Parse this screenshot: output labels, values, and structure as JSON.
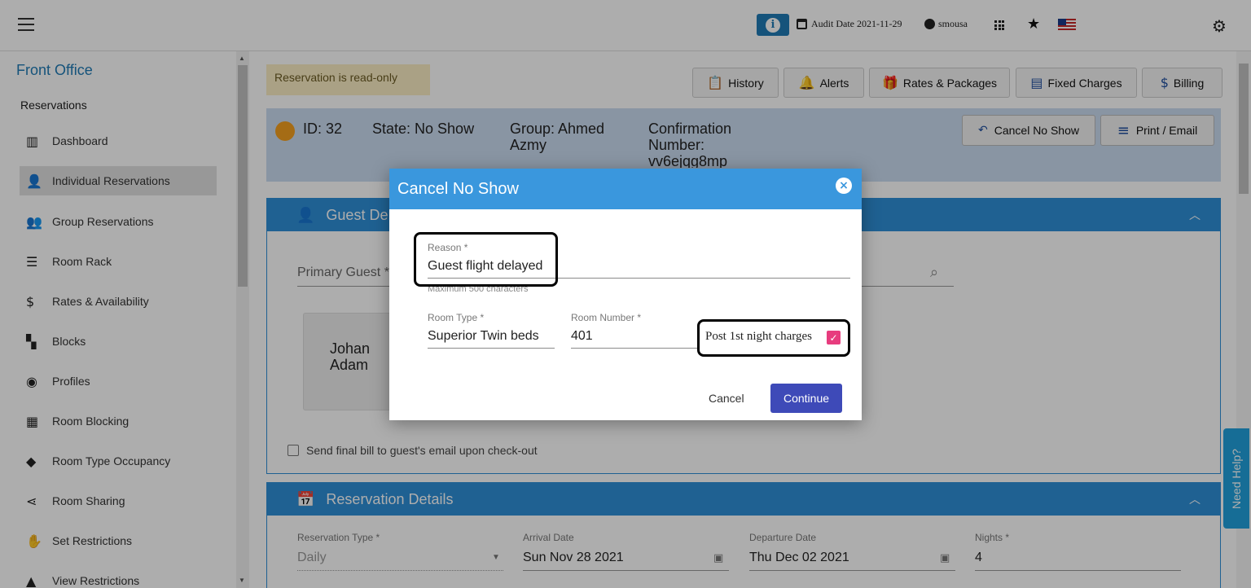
{
  "topbar": {
    "audit_label": "Audit Date 2021-11-29",
    "username": "smousa",
    "info_glyph": "i"
  },
  "sidebar": {
    "section_title": "Front Office",
    "group_title": "Reservations",
    "items": [
      {
        "label": "Dashboard",
        "icon": "dashboard-icon"
      },
      {
        "label": "Individual Reservations",
        "icon": "person-icon"
      },
      {
        "label": "Group Reservations",
        "icon": "group-icon"
      },
      {
        "label": "Room Rack",
        "icon": "list-icon"
      },
      {
        "label": "Rates & Availability",
        "icon": "dollar-icon"
      },
      {
        "label": "Blocks",
        "icon": "blocks-icon"
      },
      {
        "label": "Profiles",
        "icon": "profile-icon"
      },
      {
        "label": "Room Blocking",
        "icon": "table-icon"
      },
      {
        "label": "Room Type Occupancy",
        "icon": "label-icon"
      },
      {
        "label": "Room Sharing",
        "icon": "share-icon"
      },
      {
        "label": "Set Restrictions",
        "icon": "hand-icon"
      },
      {
        "label": "View Restrictions",
        "icon": "warning-icon"
      }
    ],
    "active_index": 1
  },
  "main": {
    "readonly_notice": "Reservation is read-only",
    "toolbar": {
      "history": "History",
      "alerts": "Alerts",
      "rates": "Rates & Packages",
      "fixed": "Fixed Charges",
      "billing": "Billing"
    },
    "info": {
      "id": "ID: 32",
      "state": "State: No Show",
      "group_line1": "Group: Ahmed",
      "group_line2": "Azmy",
      "conf_line1": "Confirmation",
      "conf_line2": "Number:",
      "conf_line3": "vv6ejqg8mp",
      "cancel_no_show": "Cancel No Show",
      "print_email": "Print / Email"
    },
    "guest_panel": {
      "title": "Guest De",
      "primary_guest_label": "Primary Guest *",
      "guest_first": "Johan",
      "guest_last": "Adam",
      "send_bill": "Send final bill to guest's email upon check-out"
    },
    "reservation_panel": {
      "title": "Reservation Details",
      "type_label": "Reservation Type *",
      "type_value": "Daily",
      "arrival_label": "Arrival Date",
      "arrival_value": "Sun Nov 28 2021",
      "departure_label": "Departure Date",
      "departure_value": "Thu Dec 02 2021",
      "nights_label": "Nights *",
      "nights_value": "4"
    }
  },
  "modal": {
    "title": "Cancel No Show",
    "reason_label": "Reason *",
    "reason_value": "Guest flight delayed",
    "reason_hint": "Maximum 500 characters",
    "room_type_label": "Room Type *",
    "room_type_value": "Superior Twin beds",
    "room_number_label": "Room Number *",
    "room_number_value": "401",
    "post_charges_label": "Post 1st night charges",
    "post_charges_checked": true,
    "cancel": "Cancel",
    "continue": "Continue"
  },
  "help_tab": "Need Help?",
  "colors": {
    "primary": "#2f8fd8",
    "modal_header": "#3a97dd",
    "continue_button": "#3e4ab8",
    "checkbox": "#e73c7e",
    "readonly_bg": "#fbeec4"
  }
}
